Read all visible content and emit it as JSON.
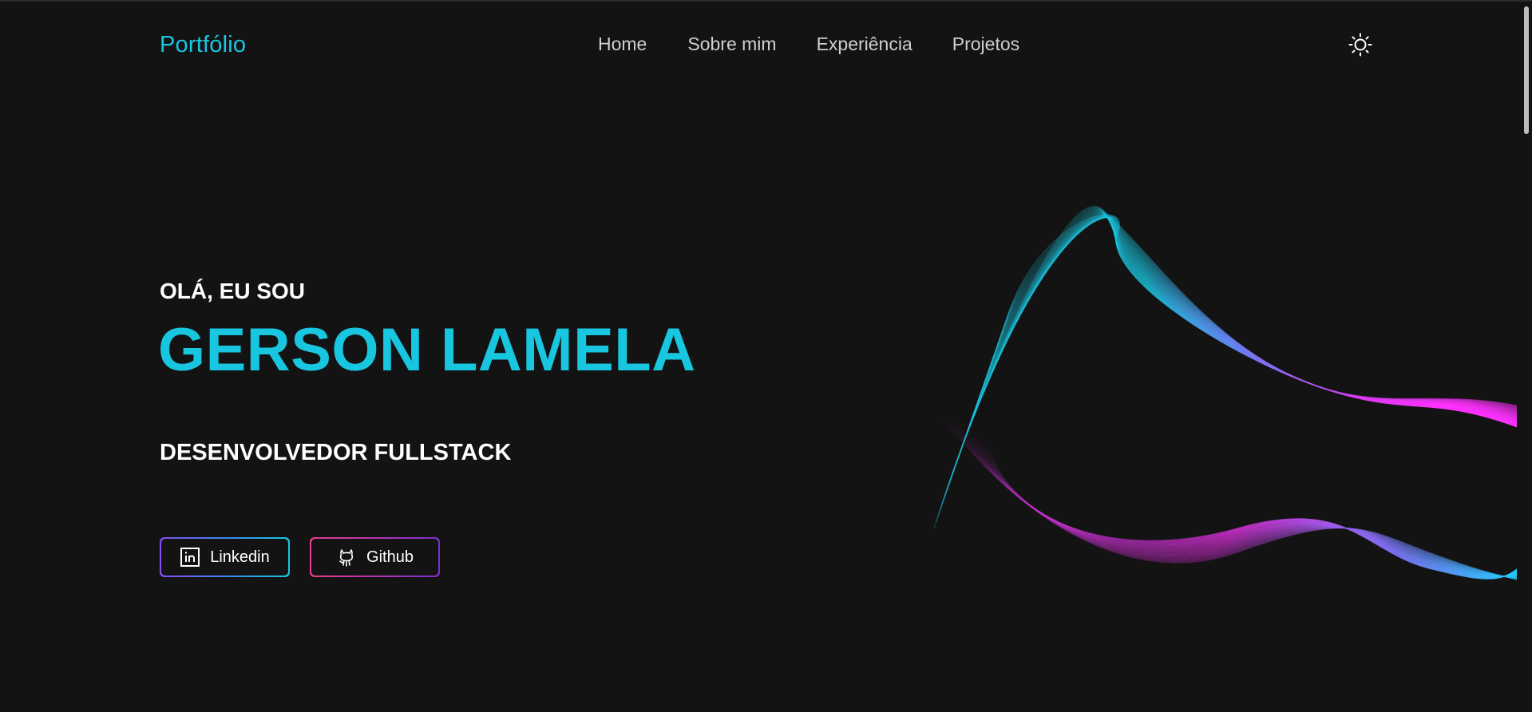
{
  "header": {
    "brand": "Portfólio",
    "nav": [
      "Home",
      "Sobre mim",
      "Experiência",
      "Projetos"
    ],
    "theme_toggle_icon": "sun-icon"
  },
  "hero": {
    "greeting": "OLÁ, EU SOU",
    "name": "GERSON LAMELA",
    "role": "DESENVOLVEDOR FULLSTACK",
    "buttons": {
      "linkedin": {
        "label": "Linkedin",
        "icon": "linkedin-icon"
      },
      "github": {
        "label": "Github",
        "icon": "github-icon"
      }
    }
  },
  "decoration": {
    "icon": "wave-lines-graphic"
  },
  "colors": {
    "background": "#131313",
    "accent": "#19c6e0",
    "magenta": "#e030f0",
    "text": "#ffffff"
  }
}
